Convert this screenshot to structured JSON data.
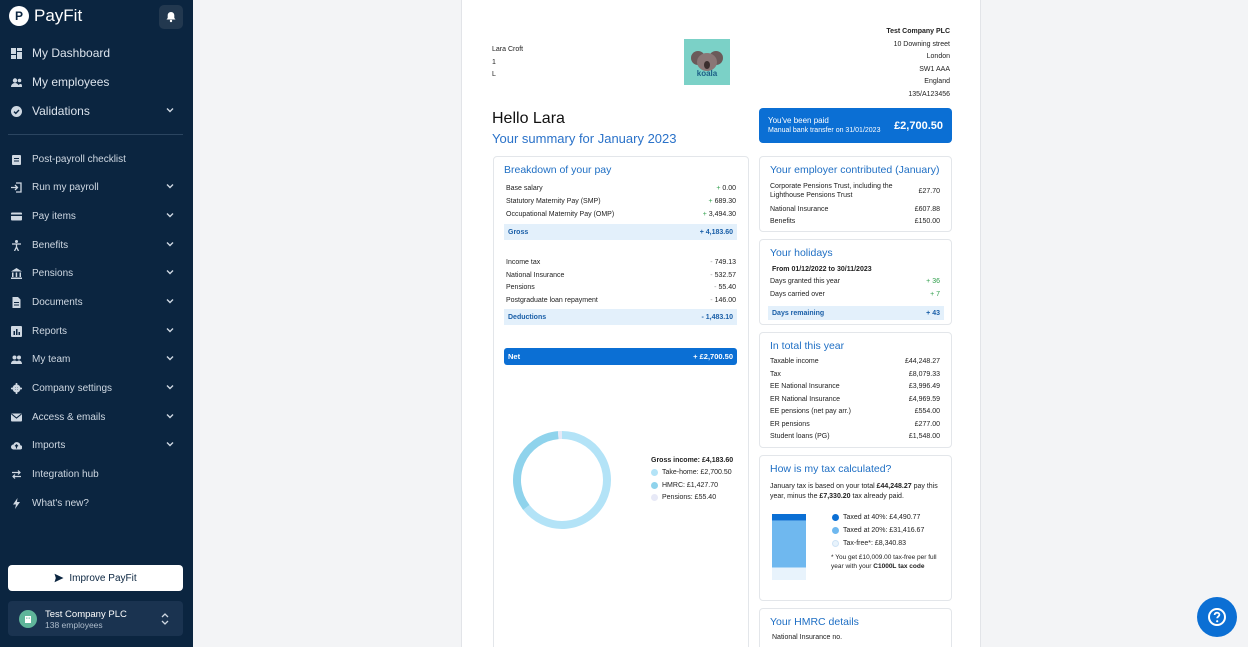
{
  "sidebar": {
    "brand": "PayFit",
    "logo_letter": "P",
    "items": [
      {
        "label": "My Dashboard",
        "icon": "dashboard-icon",
        "chevron": false
      },
      {
        "label": "My employees",
        "icon": "people-icon",
        "chevron": false
      },
      {
        "label": "Validations",
        "icon": "check-circle-icon",
        "chevron": true
      },
      {
        "label": "Post-payroll checklist",
        "icon": "clipboard-icon",
        "chevron": false
      },
      {
        "label": "Run my payroll",
        "icon": "login-arrow-icon",
        "chevron": true
      },
      {
        "label": "Pay items",
        "icon": "card-icon",
        "chevron": true
      },
      {
        "label": "Benefits",
        "icon": "person-icon",
        "chevron": true
      },
      {
        "label": "Pensions",
        "icon": "bank-icon",
        "chevron": true
      },
      {
        "label": "Documents",
        "icon": "document-icon",
        "chevron": true
      },
      {
        "label": "Reports",
        "icon": "chart-icon",
        "chevron": true
      },
      {
        "label": "My team",
        "icon": "team-icon",
        "chevron": true
      },
      {
        "label": "Company settings",
        "icon": "gear-icon",
        "chevron": true
      },
      {
        "label": "Access & emails",
        "icon": "mail-icon",
        "chevron": true
      },
      {
        "label": "Imports",
        "icon": "cloud-upload-icon",
        "chevron": true
      },
      {
        "label": "Integration hub",
        "icon": "swap-icon",
        "chevron": false
      },
      {
        "label": "What's new?",
        "icon": "bolt-icon",
        "chevron": false
      }
    ],
    "improve_label": "Improve PayFit",
    "company_name": "Test Company PLC",
    "company_employees": "138 employees"
  },
  "payslip": {
    "employee": {
      "name": "Lara Croft",
      "line1": "1",
      "line2": "L"
    },
    "logo_text": "koala",
    "company_address": [
      "Test Company PLC",
      "10 Downing street",
      "London",
      "SW1 AAA",
      "England",
      "135/A123456"
    ],
    "hello": "Hello Lara",
    "summary": "Your summary for January 2023",
    "paid": {
      "title": "You've been paid",
      "sub": "Manual bank transfer on 31/01/2023",
      "amount": "£2,700.50"
    },
    "breakdown": {
      "title": "Breakdown of your pay",
      "earnings": [
        {
          "label": "Base salary",
          "sign": "+",
          "value": "0.00"
        },
        {
          "label": "Statutory Maternity Pay (SMP)",
          "sign": "+",
          "value": "689.30"
        },
        {
          "label": "Occupational Maternity Pay (OMP)",
          "sign": "+",
          "value": "3,494.30"
        }
      ],
      "gross": {
        "label": "Gross",
        "value": "+ 4,183.60"
      },
      "deductions": [
        {
          "label": "Income tax",
          "sign": "-",
          "value": "749.13"
        },
        {
          "label": "National Insurance",
          "sign": "-",
          "value": "532.57"
        },
        {
          "label": "Pensions",
          "sign": "-",
          "value": "55.40"
        },
        {
          "label": "Postgraduate loan repayment",
          "sign": "-",
          "value": "146.00"
        }
      ],
      "deductions_total": {
        "label": "Deductions",
        "value": "- 1,483.10"
      },
      "net": {
        "label": "Net",
        "value": "+ £2,700.50"
      },
      "donut": {
        "title": "Gross income: £4,183.60",
        "legend": [
          {
            "label": "Take-home: £2,700.50",
            "value": 2700.5,
            "color": "#b3e3f7"
          },
          {
            "label": "HMRC: £1,427.70",
            "value": 1427.7,
            "color": "#8fd3ec"
          },
          {
            "label": "Pensions: £55.40",
            "value": 55.4,
            "color": "#e7e9f7"
          }
        ]
      }
    },
    "employer": {
      "title": "Your employer contributed (January)",
      "rows": [
        {
          "label": "Corporate Pensions Trust, including the Lighthouse Pensions Trust",
          "value": "£27.70"
        },
        {
          "label": "National Insurance",
          "value": "£607.88"
        },
        {
          "label": "Benefits",
          "value": "£150.00"
        }
      ]
    },
    "holidays": {
      "title": "Your holidays",
      "period": "From 01/12/2022 to 30/11/2023",
      "rows": [
        {
          "label": "Days granted this year",
          "value": "+ 36"
        },
        {
          "label": "Days carried over",
          "value": "+ 7"
        }
      ],
      "remaining": {
        "label": "Days remaining",
        "value": "+ 43"
      }
    },
    "total_year": {
      "title": "In total this year",
      "rows": [
        {
          "label": "Taxable income",
          "value": "£44,248.27"
        },
        {
          "label": "Tax",
          "value": "£8,079.33"
        },
        {
          "label": "EE National Insurance",
          "value": "£3,996.49"
        },
        {
          "label": "ER National Insurance",
          "value": "£4,969.59"
        },
        {
          "label": "EE pensions (net pay arr.)",
          "value": "£554.00"
        },
        {
          "label": "ER pensions",
          "value": "£277.00"
        },
        {
          "label": "Student loans (PG)",
          "value": "£1,548.00"
        }
      ]
    },
    "tax": {
      "title": "How is my tax calculated?",
      "text_a": "January tax is based on your total ",
      "text_b": "£44,248.27",
      "text_c": " pay this year, minus the ",
      "text_d": "£7,330.20",
      "text_e": " tax already paid.",
      "legend": [
        {
          "label": "Taxed at 40%: £4,490.77",
          "value": 4490.77,
          "color": "#0b6fd4"
        },
        {
          "label": "Taxed at 20%: £31,416.67",
          "value": 31416.67,
          "color": "#6fb8ef"
        },
        {
          "label": "Tax-free*: £8,340.83",
          "value": 8340.83,
          "color": "#e8f3fc"
        }
      ],
      "note_a": "* You get £10,009.00 tax-free per full year with your ",
      "note_b": "C1000L tax code"
    },
    "hmrc": {
      "title": "Your HMRC details",
      "row": "National Insurance no."
    }
  }
}
